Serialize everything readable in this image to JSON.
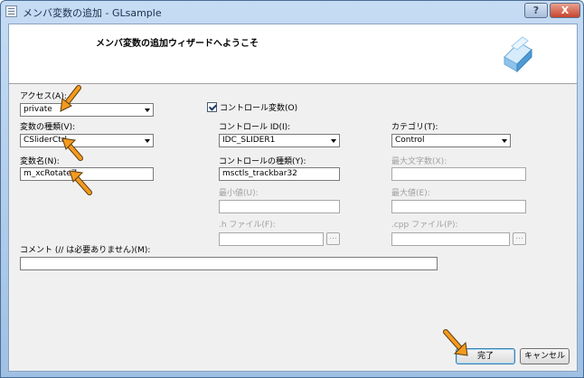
{
  "window": {
    "title": "メンバ変数の追加 - GLsample",
    "help_glyph": "?",
    "close_glyph": "X"
  },
  "banner": {
    "title": "メンバ変数の追加ウィザードへようこそ"
  },
  "form": {
    "access": {
      "label": "アクセス(A):",
      "value": "private"
    },
    "var_type": {
      "label": "変数の種類(V):",
      "value": "CSliderCtrl"
    },
    "var_name": {
      "label": "変数名(N):",
      "value": "m_xcRotateZ"
    },
    "control_var": {
      "label": "コントロール変数(O)",
      "checked": true
    },
    "control_id": {
      "label": "コントロール ID(I):",
      "value": "IDC_SLIDER1"
    },
    "control_type": {
      "label": "コントロールの種類(Y):",
      "value": "msctls_trackbar32"
    },
    "min_value": {
      "label": "最小値(U):",
      "value": ""
    },
    "h_file": {
      "label": ".h ファイル(F):",
      "value": "",
      "browse": "..."
    },
    "category": {
      "label": "カテゴリ(T):",
      "value": "Control"
    },
    "max_chars": {
      "label": "最大文字数(X):",
      "value": ""
    },
    "max_value": {
      "label": "最大値(E):",
      "value": ""
    },
    "cpp_file": {
      "label": ".cpp ファイル(P):",
      "value": "",
      "browse": "..."
    },
    "comment": {
      "label": "コメント (// は必要ありません)(M):",
      "value": ""
    }
  },
  "buttons": {
    "finish": "完了",
    "cancel": "キャンセル"
  },
  "colors": {
    "arrow": "#f39a1e",
    "title_bar": "#b5d0ee"
  }
}
